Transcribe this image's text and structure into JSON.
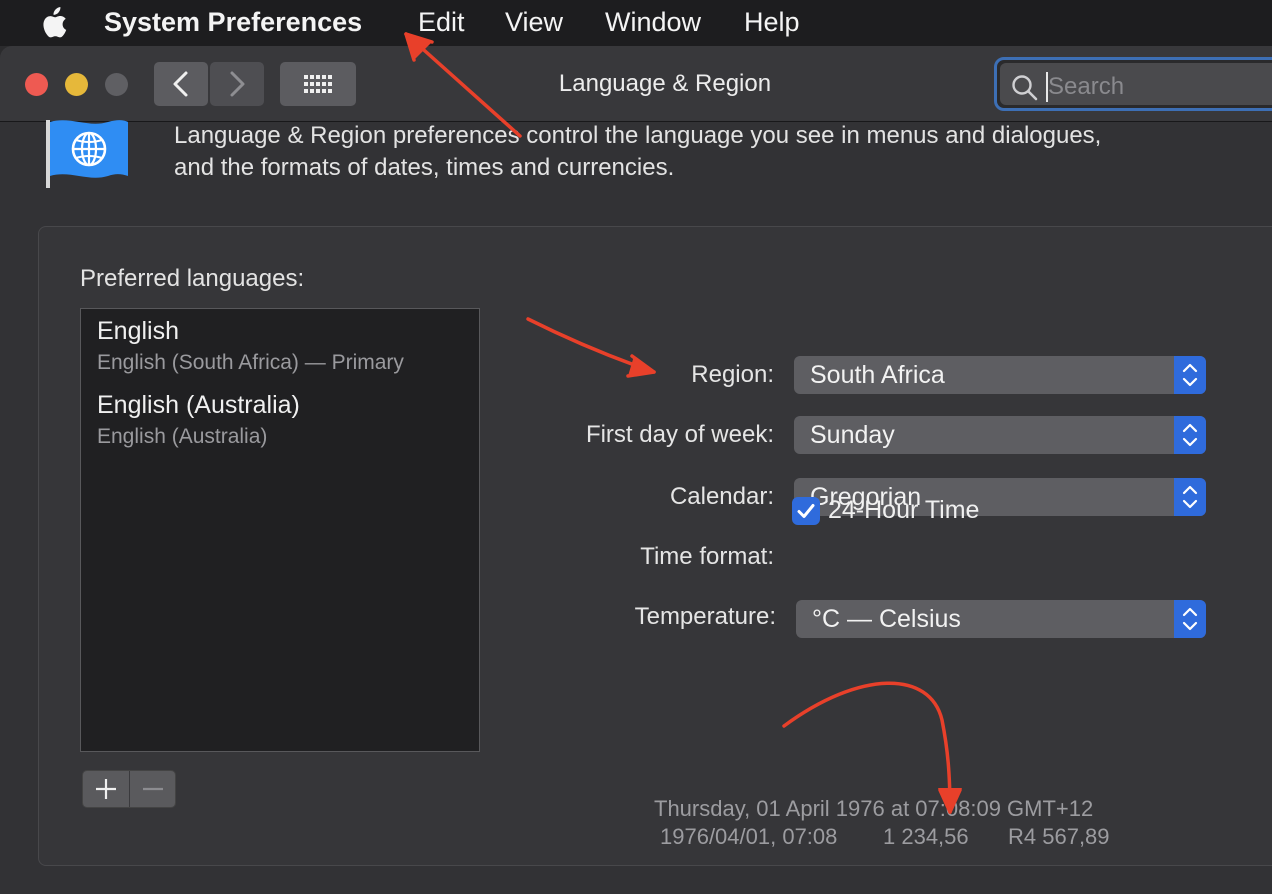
{
  "menubar": {
    "app_name": "System Preferences",
    "items": [
      "Edit",
      "View",
      "Window",
      "Help"
    ]
  },
  "window": {
    "title": "Language & Region",
    "search_placeholder": "Search"
  },
  "header": {
    "description_line1": "Language & Region preferences control the language you see in menus and dialogues,",
    "description_line2": "and the formats of dates, times and currencies."
  },
  "languages": {
    "label": "Preferred languages:",
    "items": [
      {
        "name": "English",
        "detail": "English (South Africa) — Primary"
      },
      {
        "name": "English (Australia)",
        "detail": "English (Australia)"
      }
    ],
    "add_symbol": "+",
    "remove_symbol": "−"
  },
  "settings": {
    "region": {
      "label": "Region:",
      "value": "South Africa"
    },
    "first_day": {
      "label": "First day of week:",
      "value": "Sunday"
    },
    "calendar": {
      "label": "Calendar:",
      "value": "Gregorian"
    },
    "time_format": {
      "label": "Time format:",
      "checkbox_label": "24-Hour Time",
      "checked": true
    },
    "temperature": {
      "label": "Temperature:",
      "value": "°C — Celsius"
    }
  },
  "samples": {
    "date_long": "Thursday, 01 April 1976 at 07:08:09 GMT+12",
    "date_short": "1976/04/01, 07:08",
    "number": "1 234,56",
    "currency": "R4 567,89"
  },
  "colors": {
    "accent": "#2f6bdc",
    "annotation": "#e8402a"
  }
}
